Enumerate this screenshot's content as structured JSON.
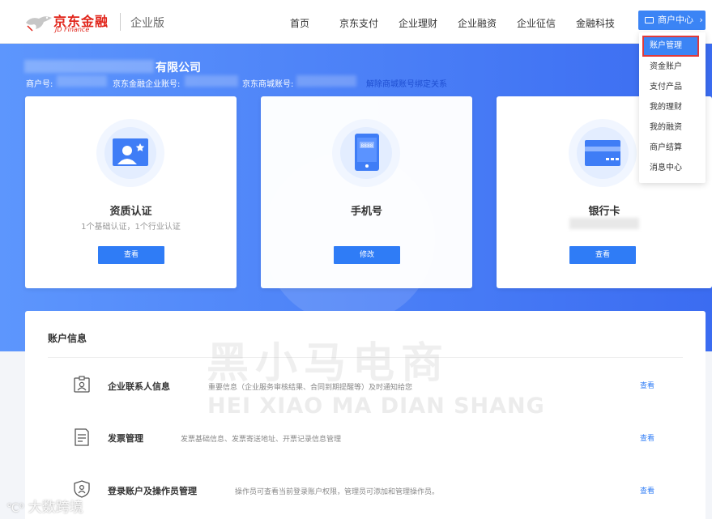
{
  "header": {
    "brand_name": "京东金融",
    "brand_sub": "JD Finance",
    "edition": "企业版",
    "nav": [
      "首页",
      "京东支付",
      "企业理财",
      "企业融资",
      "企业征信",
      "金融科技"
    ],
    "merchant_center": "商户中心",
    "merchant_center_chevron": "›"
  },
  "dropdown": {
    "items": [
      "账户管理",
      "资金账户",
      "支付产品",
      "我的理财",
      "我的融资",
      "商户结算",
      "消息中心"
    ],
    "active_index": 0
  },
  "hero": {
    "company_suffix": "有限公司",
    "merchant_no_label": "商户号:",
    "enterprise_account_label": "京东金融企业账号:",
    "mall_account_label": "京东商城账号:",
    "unbind_link": "解除商城账号绑定关系"
  },
  "cards": [
    {
      "title": "资质认证",
      "subtitle": "1个基础认证，1个行业认证",
      "button": "查看",
      "icon": "id-card-icon"
    },
    {
      "title": "手机号",
      "subtitle": "",
      "button": "修改",
      "icon": "mobile-phone-icon",
      "phone_screen_text": "8888"
    },
    {
      "title": "银行卡",
      "subtitle": "",
      "button": "查看",
      "icon": "bank-card-icon"
    }
  ],
  "account_info": {
    "title": "账户信息",
    "rows": [
      {
        "title": "企业联系人信息",
        "desc": "重要信息（企业服务审核结果、合同到期提醒等）及时通知给您",
        "link": "查看",
        "icon": "contact-badge-icon"
      },
      {
        "title": "发票管理",
        "desc": "发票基础信息、发票寄送地址、开票记录信息管理",
        "link": "查看",
        "icon": "invoice-document-icon"
      },
      {
        "title": "登录账户及操作员管理",
        "desc": "操作员可查看当前登录账户权限，管理员可添加和管理操作员。",
        "link": "查看",
        "icon": "shield-user-icon"
      }
    ]
  },
  "watermark": {
    "cn": "黑小马电商",
    "en": "HEI XIAO MA DIAN SHANG",
    "corner": "大数跨境"
  },
  "colors": {
    "primary": "#2f7cf6",
    "brand_red": "#e1251b",
    "hero_start": "#5d96fd",
    "hero_end": "#3b6cf1",
    "highlight_outline": "#e03a3a"
  }
}
